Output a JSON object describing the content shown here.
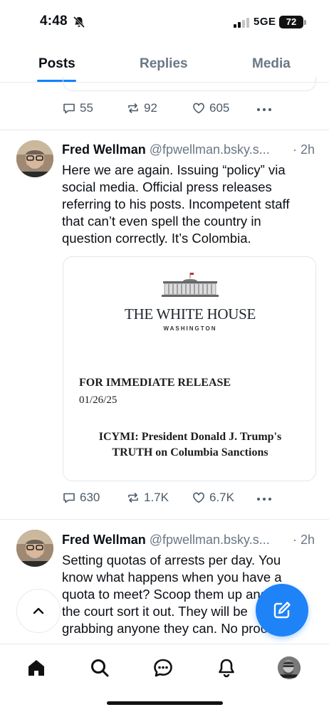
{
  "status_bar": {
    "time": "4:48",
    "network": "5GE",
    "battery": "72"
  },
  "tabs": [
    {
      "label": "Posts",
      "active": true
    },
    {
      "label": "Replies",
      "active": false
    },
    {
      "label": "Media",
      "active": false
    }
  ],
  "previous_post": {
    "replies": "55",
    "reposts": "92",
    "likes": "605"
  },
  "posts": [
    {
      "author": "Fred Wellman",
      "handle": "@fpwellman.bsky.s...",
      "time": "· 2h",
      "text": "Here we are again. Issuing “policy” via\nsocial media. Official press releases\nreferring to his posts. Incompetent staff\nthat can’t even spell the country in\nquestion correctly. It’s Colombia.",
      "embed": {
        "org_title": "THE WHITE HOUSE",
        "org_sub": "WASHINGTON",
        "release_label": "FOR IMMEDIATE RELEASE",
        "release_date": "01/26/25",
        "headline": "ICYMI: President Donald J. Trump's\nTRUTH on Columbia Sanctions"
      },
      "replies": "630",
      "reposts": "1.7K",
      "likes": "6.7K"
    },
    {
      "author": "Fred Wellman",
      "handle": "@fpwellman.bsky.s...",
      "time": "· 2h",
      "text": "Setting quotas of arrests per day. You\nknow what happens when you have a\nquota to meet? Scoop them up and let\nthe court sort it out. They will be\ngrabbing anyone they can. No proof of"
    }
  ],
  "colors": {
    "accent": "#1083fe",
    "fab": "#1e83f7",
    "muted": "#6b7785"
  },
  "bottom_nav": [
    "home-icon",
    "search-icon",
    "chat-icon",
    "bell-icon",
    "profile-avatar"
  ]
}
